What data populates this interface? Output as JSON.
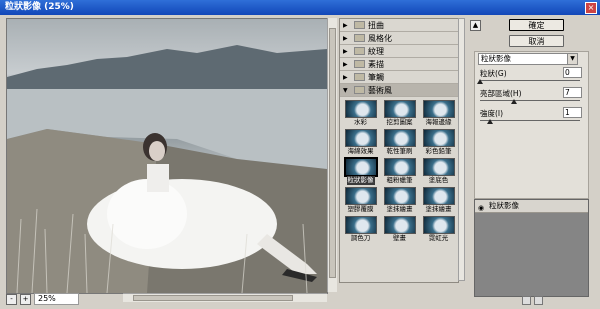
{
  "window": {
    "title": "粒狀影像 (25%)",
    "close": "×"
  },
  "preview": {
    "zoom": "25%",
    "zoom_minus": "-",
    "zoom_plus": "+"
  },
  "gallery": {
    "folders": [
      {
        "label": "扭曲",
        "open": false
      },
      {
        "label": "風格化",
        "open": false
      },
      {
        "label": "紋理",
        "open": false
      },
      {
        "label": "素描",
        "open": false
      },
      {
        "label": "筆觸",
        "open": false
      },
      {
        "label": "藝術風",
        "open": true
      }
    ],
    "filters": [
      {
        "label": "水彩",
        "selected": false
      },
      {
        "label": "挖剪圖案",
        "selected": false
      },
      {
        "label": "海報邊緣",
        "selected": false
      },
      {
        "label": "海綿效果",
        "selected": false
      },
      {
        "label": "乾性筆刷",
        "selected": false
      },
      {
        "label": "彩色鉛筆",
        "selected": false
      },
      {
        "label": "粒狀影像",
        "selected": true
      },
      {
        "label": "粗粉蠟筆",
        "selected": false
      },
      {
        "label": "塗底色",
        "selected": false
      },
      {
        "label": "塑膠覆膜",
        "selected": false
      },
      {
        "label": "塗抹繪畫",
        "selected": false
      },
      {
        "label": "塗抹繪畫",
        "selected": false
      },
      {
        "label": "調色刀",
        "selected": false
      },
      {
        "label": "壁畫",
        "selected": false
      },
      {
        "label": "霓虹光",
        "selected": false
      }
    ]
  },
  "buttons": {
    "ok": "確定",
    "cancel": "取消",
    "collapse": "▲"
  },
  "settings": {
    "filter_select": "粒狀影像",
    "params": [
      {
        "label": "粒狀(G)",
        "value": "0",
        "fraction": 0.0
      },
      {
        "label": "亮部區域(H)",
        "value": "7",
        "fraction": 0.35
      },
      {
        "label": "強度(I)",
        "value": "1",
        "fraction": 0.1
      }
    ]
  },
  "layers": {
    "items": [
      {
        "label": "粒狀影像"
      }
    ]
  }
}
